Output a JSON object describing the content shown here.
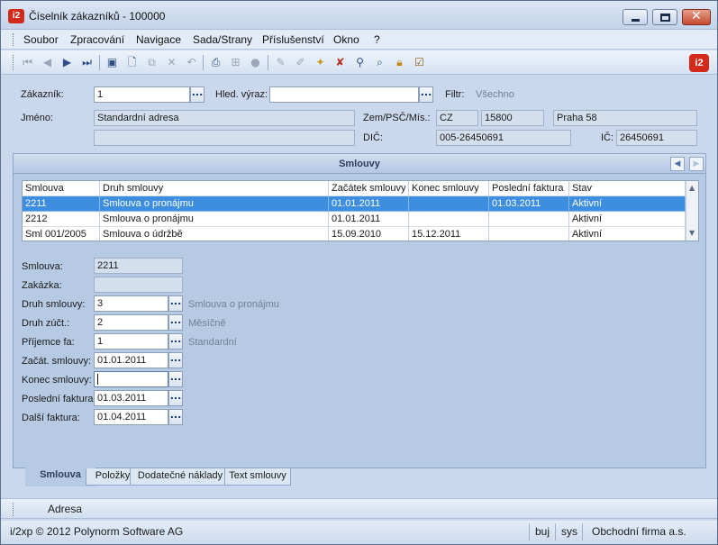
{
  "window": {
    "title": "Číselník zákazníků - 100000",
    "logo_text": "i2"
  },
  "menu": [
    "Soubor",
    "Zpracování",
    "Navigace",
    "Sada/Strany",
    "Příslušenství",
    "Okno",
    "?"
  ],
  "toolbar": {
    "icons": [
      "first-record-icon",
      "prev-record-icon",
      "next-record-icon",
      "last-record-icon",
      "save-icon",
      "new-icon",
      "copy-icon",
      "delete-icon",
      "undo-icon",
      "print-icon",
      "tree-icon",
      "stop-icon",
      "edit-icon",
      "edit-alt-icon",
      "filter-icon",
      "clear-filter-icon",
      "search-icon",
      "find-icon",
      "lock-icon",
      "checklist-icon"
    ]
  },
  "header_form": {
    "zakaznik_label": "Zákazník:",
    "zakaznik_value": "1",
    "hled_label": "Hled. výraz:",
    "hled_value": "",
    "filtr_label": "Filtr:",
    "filtr_value": "Všechno",
    "jmeno_label": "Jméno:",
    "jmeno_value": "Standardní adresa",
    "jmeno2_value": "",
    "zem_label": "Zem/PSČ/Mís.:",
    "zem_value": "CZ",
    "psc_value": "15800",
    "misto_value": "Praha 58",
    "dic_label": "DIČ:",
    "dic_value": "005-26450691",
    "ic_label": "IČ:",
    "ic_value": "26450691",
    "dots": "..."
  },
  "panel": {
    "title": "Smlouvy"
  },
  "grid": {
    "columns": [
      "Smlouva",
      "Druh smlouvy",
      "Začátek smlouvy",
      "Konec smlouvy",
      "Poslední faktura",
      "Stav"
    ],
    "rows": [
      [
        "2211",
        "Smlouva o pronájmu",
        "01.01.2011",
        "",
        "01.03.2011",
        "Aktivní"
      ],
      [
        "2212",
        "Smlouva o pronájmu",
        "01.01.2011",
        "",
        "",
        "Aktivní"
      ],
      [
        "Sml 001/2005",
        "Smlouva o údržbě",
        "15.09.2010",
        "15.12.2011",
        "",
        "Aktivní"
      ]
    ]
  },
  "detail": {
    "smlouva_label": "Smlouva:",
    "smlouva_value": "2211",
    "zakazka_label": "Zakázka:",
    "zakazka_value": "",
    "druh_label": "Druh smlouvy:",
    "druh_value": "3",
    "druh_desc": "Smlouva o pronájmu",
    "druh_zuct_label": "Druh zúčt.:",
    "druh_zuct_value": "2",
    "druh_zuct_desc": "Měsíčně",
    "prijemce_label": "Příjemce fa:",
    "prijemce_value": "1",
    "prijemce_desc": "Standardní",
    "zacat_label": "Začát. smlouvy:",
    "zacat_value": "01.01.2011",
    "konec_label": "Konec smlouvy:",
    "konec_value": "",
    "posledni_label": "Poslední faktura:",
    "posledni_value": "01.03.2011",
    "dalsi_label": "Další faktura:",
    "dalsi_value": "01.04.2011"
  },
  "tabs": [
    "Smlouva",
    "Položky",
    "Dodatečné náklady",
    "Text smlouvy"
  ],
  "adresa_label": "Adresa",
  "status": {
    "copyright": "i/2xp © 2012 Polynorm Software AG",
    "user": "buj",
    "db": "sys",
    "company": "Obchodní firma a.s."
  },
  "colors": {
    "selection": "#3d8ee0",
    "panel": "#b7cae4",
    "logo": "#d42a1c"
  }
}
